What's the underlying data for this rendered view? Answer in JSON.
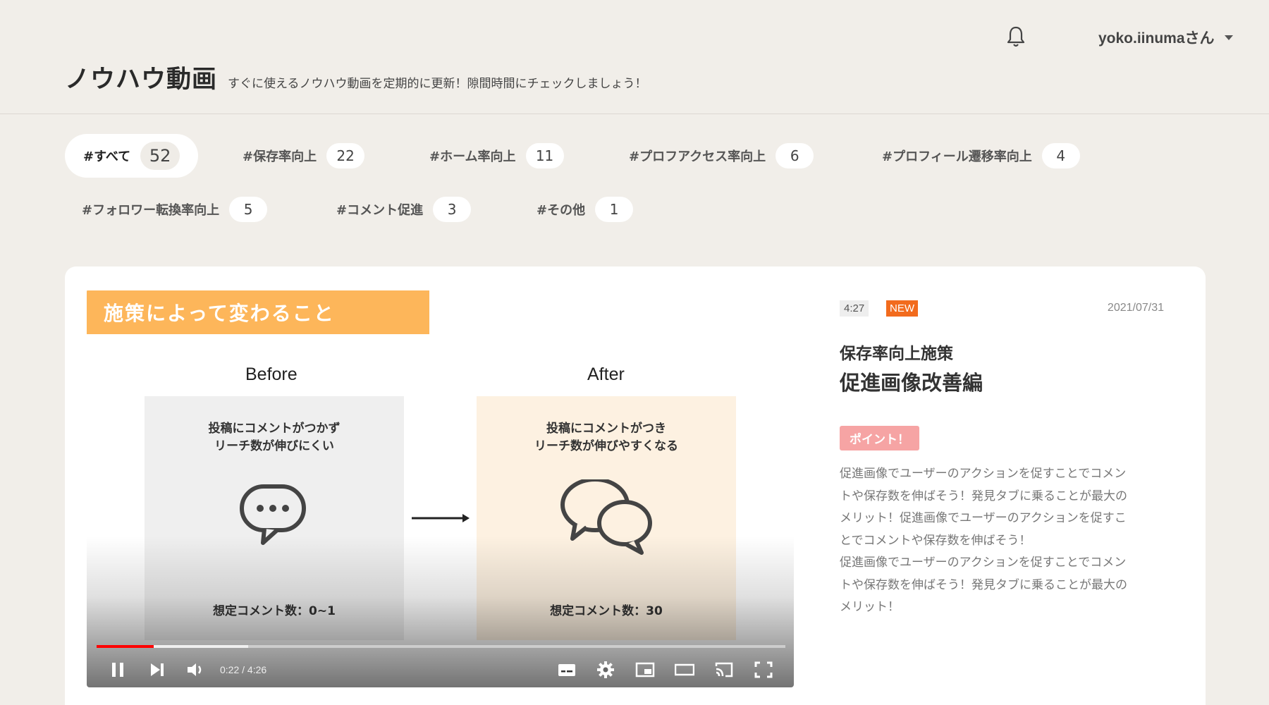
{
  "header": {
    "user_name": "yoko.iinumaさん",
    "page_title": "ノウハウ動画",
    "page_subtitle": "すぐに使えるノウハウ動画を定期的に更新！隙間時間にチェックしましょう！"
  },
  "tags": [
    {
      "label": "#すべて",
      "count": "52",
      "active": true
    },
    {
      "label": "#保存率向上",
      "count": "22"
    },
    {
      "label": "#ホーム率向上",
      "count": "11"
    },
    {
      "label": "#プロフアクセス率向上",
      "count": "6"
    },
    {
      "label": "#プロフィール遷移率向上",
      "count": "4"
    },
    {
      "label": "#フォロワー転換率向上",
      "count": "5"
    },
    {
      "label": "#コメント促進",
      "count": "3"
    },
    {
      "label": "#その他",
      "count": "1"
    }
  ],
  "video": {
    "slide": {
      "banner": "施策によって変わること",
      "before_label": "Before",
      "after_label": "After",
      "before_text": "投稿にコメントがつかず\nリーチ数が伸びにくい",
      "after_text": "投稿にコメントがつき\nリーチ数が伸びやすくなる",
      "before_foot": "想定コメント数：0~1",
      "after_foot": "想定コメント数：30"
    },
    "time_display": "0:22 / 4:26",
    "played_fraction": 0.083,
    "buffered_fraction": 0.22
  },
  "meta": {
    "duration": "4:27",
    "badge": "NEW",
    "date": "2021/07/31",
    "title_line1": "保存率向上施策",
    "title_line2": "促進画像改善編",
    "point_label": "ポイント！",
    "description": "促進画像でユーザーのアクションを促すことでコメン\nトや保存数を伸ばそう！発見タブに乗ることが最大の\nメリット！促進画像でユーザーのアクションを促すこ\nとでコメントや保存数を伸ばそう！\n促進画像でユーザーのアクションを促すことでコメン\nトや保存数を伸ばそう！発見タブに乗ることが最大の\nメリット！"
  },
  "colors": {
    "background": "#f1eee9",
    "banner": "#fdb65a",
    "new_badge": "#f26b1d",
    "point_badge": "#f6a4a4",
    "progress": "#ff0000"
  },
  "icons": [
    "bell-icon",
    "caret-down-icon",
    "speech-bubble-icon",
    "double-speech-bubble-icon",
    "arrow-right-icon",
    "pause-icon",
    "next-icon",
    "volume-icon",
    "subtitles-icon",
    "settings-icon",
    "miniplayer-icon",
    "theater-icon",
    "cast-icon",
    "fullscreen-icon"
  ]
}
